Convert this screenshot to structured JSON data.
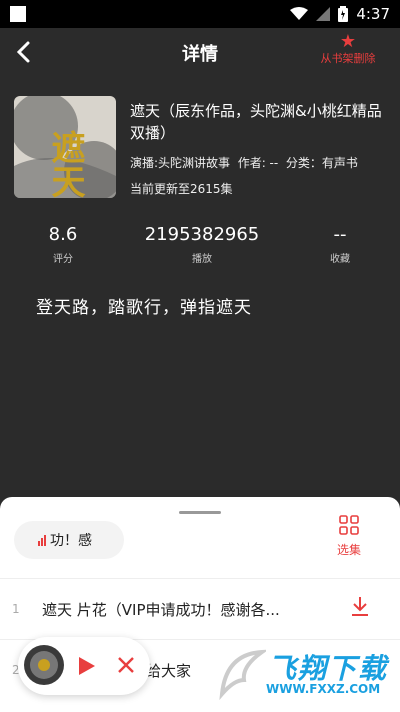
{
  "status_bar": {
    "time": "4:37"
  },
  "header": {
    "title": "详情",
    "remove_label": "从书架删除"
  },
  "book": {
    "title": "遮天（辰东作品，头陀渊&小桃红精品双播）",
    "cover_text": "遮天",
    "narrator_line": "演播:头陀渊讲故事",
    "author_line": "作者: --",
    "category_line": "分类：有声书",
    "update_line": "当前更新至2615集"
  },
  "stats": [
    {
      "value": "8.6",
      "label": "评分"
    },
    {
      "value": "2195382965",
      "label": "播放"
    },
    {
      "value": "--",
      "label": "收藏"
    }
  ],
  "description": "登天路，踏歌行，弹指遮天",
  "sheet": {
    "now_playing_snippet": "功！感",
    "select_label": "选集",
    "episodes": [
      {
        "index": "1",
        "title": "遮天 片花（VIP申请成功！感谢各..."
      },
      {
        "index": "2",
        "title": "给大家"
      }
    ]
  },
  "watermark": {
    "title": "飞翔下载",
    "url": "WWW.FXXZ.COM"
  },
  "colors": {
    "accent": "#e83e3e",
    "background": "#2b2b2b"
  },
  "icons": {
    "back": "chevron-left-icon",
    "remove": "star-icon",
    "select": "grid-icon",
    "download": "download-icon",
    "play": "play-icon",
    "close": "close-icon"
  }
}
